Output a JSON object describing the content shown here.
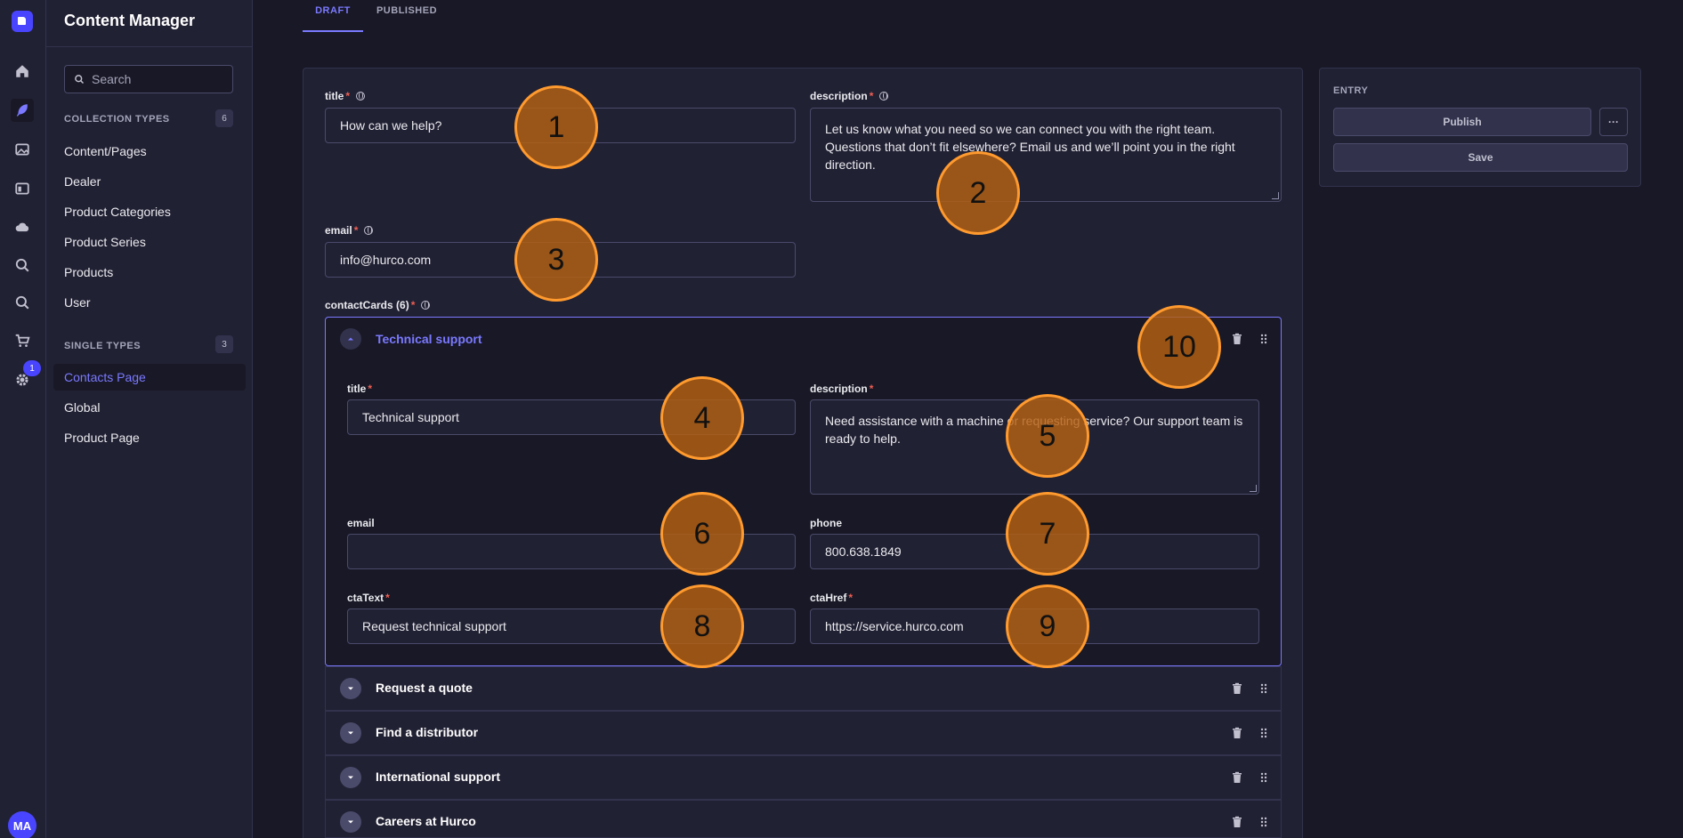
{
  "app": {
    "title": "Content Manager",
    "avatar_initials": "MA",
    "settings_badge": "1"
  },
  "rail": {
    "icons": [
      "home-icon",
      "feather-icon",
      "images-icon",
      "layout-icon",
      "cloud-icon",
      "search-icon",
      "search-icon",
      "cart-icon",
      "gear-icon"
    ]
  },
  "sidebar": {
    "search_placeholder": "Search",
    "collection_types": {
      "heading": "COLLECTION TYPES",
      "count": "6",
      "items": [
        "Content/Pages",
        "Dealer",
        "Product Categories",
        "Product Series",
        "Products",
        "User"
      ]
    },
    "single_types": {
      "heading": "SINGLE TYPES",
      "count": "3",
      "items": [
        "Contacts Page",
        "Global",
        "Product Page"
      ],
      "active": "Contacts Page"
    }
  },
  "tabs": {
    "draft": "DRAFT",
    "published": "PUBLISHED"
  },
  "form": {
    "title": {
      "label": "title",
      "value": "How can we help?"
    },
    "description": {
      "label": "description",
      "value": "Let us know what you need so we can connect you with the right team. Questions that don’t fit elsewhere? Email us and we’ll point you in the right direction."
    },
    "email": {
      "label": "email",
      "value": "info@hurco.com"
    },
    "contact_cards": {
      "label": "contactCards (6)",
      "open_card": {
        "header": "Technical support",
        "title_label": "title",
        "title_value": "Technical support",
        "description_label": "description",
        "description_value": "Need assistance with a machine or requesting service? Our support team is ready to help.",
        "email_label": "email",
        "email_value": "",
        "phone_label": "phone",
        "phone_value": "800.638.1849",
        "cta_text_label": "ctaText",
        "cta_text_value": "Request technical support",
        "cta_href_label": "ctaHref",
        "cta_href_value": "https://service.hurco.com"
      },
      "collapsed_cards": [
        "Request a quote",
        "Find a distributor",
        "International support",
        "Careers at Hurco"
      ]
    }
  },
  "entry": {
    "label": "ENTRY",
    "publish": "Publish",
    "more": "···",
    "save": "Save"
  },
  "markers": [
    "1",
    "2",
    "3",
    "4",
    "5",
    "6",
    "7",
    "8",
    "9",
    "10"
  ],
  "colors": {
    "accent": "#7b79ff",
    "primary": "#4945ff",
    "required": "#ee5e52",
    "marker": "#ff9a2e"
  }
}
